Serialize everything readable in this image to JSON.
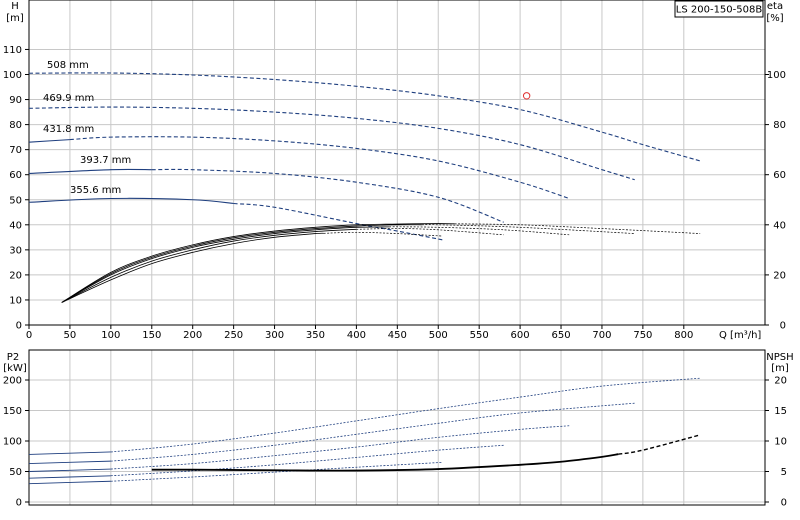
{
  "title_box": "LS 200-150-508B",
  "colors": {
    "curve": "#1f3f7f",
    "efficiency": "#000000",
    "grid": "#c8c8c8",
    "marker": "#e03030",
    "axis": "#000000"
  },
  "chart_data": [
    {
      "type": "line",
      "name": "performance",
      "left_axis": {
        "label_line1": "H",
        "label_line2": "[m]",
        "range": [
          0,
          120
        ],
        "ticks": [
          0,
          10,
          20,
          30,
          40,
          50,
          60,
          70,
          80,
          90,
          100,
          110
        ]
      },
      "right_axis": {
        "label_line1": "eta",
        "label_line2": "[%]",
        "range": [
          0,
          120
        ],
        "ticks": [
          0,
          20,
          40,
          60,
          80,
          100
        ]
      },
      "x_axis": {
        "label": "Q [m³/h]",
        "range": [
          0,
          900
        ],
        "ticks": [
          0,
          50,
          100,
          150,
          200,
          250,
          300,
          350,
          400,
          450,
          500,
          550,
          600,
          650,
          700,
          750,
          800
        ]
      },
      "grid": true,
      "head_curves": [
        {
          "name": "508 mm",
          "q_solid_end": 0,
          "points": [
            [
              0,
              100.5
            ],
            [
              100,
              100.6
            ],
            [
              200,
              99.8
            ],
            [
              300,
              98
            ],
            [
              400,
              95.3
            ],
            [
              500,
              91.5
            ],
            [
              600,
              86
            ],
            [
              700,
              77
            ],
            [
              750,
              72
            ],
            [
              820,
              65.5
            ]
          ]
        },
        {
          "name": "469.9 mm",
          "q_solid_end": 0,
          "points": [
            [
              0,
              86.5
            ],
            [
              100,
              87
            ],
            [
              200,
              86.5
            ],
            [
              300,
              85
            ],
            [
              400,
              82.5
            ],
            [
              500,
              78.5
            ],
            [
              600,
              72
            ],
            [
              700,
              62
            ],
            [
              740,
              58
            ]
          ]
        },
        {
          "name": "431.8 mm",
          "q_solid_end": 50,
          "points": [
            [
              0,
              73
            ],
            [
              100,
              75
            ],
            [
              200,
              75
            ],
            [
              300,
              73.5
            ],
            [
              400,
              70.5
            ],
            [
              500,
              65.5
            ],
            [
              600,
              57
            ],
            [
              660,
              50.5
            ]
          ]
        },
        {
          "name": "393.7 mm",
          "q_solid_end": 150,
          "points": [
            [
              0,
              60.5
            ],
            [
              100,
              62
            ],
            [
              200,
              62
            ],
            [
              300,
              60.5
            ],
            [
              400,
              57
            ],
            [
              500,
              51
            ],
            [
              580,
              41
            ]
          ]
        },
        {
          "name": "355.6 mm",
          "q_solid_end": 250,
          "points": [
            [
              0,
              49
            ],
            [
              100,
              50.5
            ],
            [
              200,
              50
            ],
            [
              300,
              47
            ],
            [
              400,
              40.5
            ],
            [
              450,
              37.5
            ],
            [
              505,
              34
            ]
          ]
        }
      ],
      "efficiency_curves": [
        {
          "name": "508 mm",
          "q_solid_end": 520,
          "points": [
            [
              40,
              9
            ],
            [
              100,
              21
            ],
            [
              150,
              27.5
            ],
            [
              200,
              32
            ],
            [
              250,
              35.3
            ],
            [
              300,
              37.5
            ],
            [
              350,
              39
            ],
            [
              400,
              40
            ],
            [
              450,
              40.3
            ],
            [
              500,
              40.5
            ],
            [
              600,
              40
            ],
            [
              700,
              38.5
            ],
            [
              820,
              36.5
            ]
          ]
        },
        {
          "name": "469.9 mm",
          "q_solid_end": 480,
          "points": [
            [
              40,
              9
            ],
            [
              100,
              20.5
            ],
            [
              150,
              27
            ],
            [
              200,
              31.5
            ],
            [
              250,
              34.8
            ],
            [
              300,
              37
            ],
            [
              350,
              38.5
            ],
            [
              400,
              39.5
            ],
            [
              450,
              40
            ],
            [
              500,
              40
            ],
            [
              600,
              39
            ],
            [
              740,
              36.5
            ]
          ]
        },
        {
          "name": "431.8 mm",
          "q_solid_end": 440,
          "points": [
            [
              40,
              9
            ],
            [
              100,
              20
            ],
            [
              150,
              26.5
            ],
            [
              200,
              31
            ],
            [
              250,
              34.2
            ],
            [
              300,
              36.5
            ],
            [
              350,
              38
            ],
            [
              400,
              39
            ],
            [
              450,
              39.2
            ],
            [
              500,
              39
            ],
            [
              580,
              38
            ],
            [
              660,
              36
            ]
          ]
        },
        {
          "name": "393.7 mm",
          "q_solid_end": 400,
          "points": [
            [
              40,
              9
            ],
            [
              100,
              19
            ],
            [
              150,
              25.5
            ],
            [
              200,
              30
            ],
            [
              250,
              33.5
            ],
            [
              300,
              35.8
            ],
            [
              350,
              37.3
            ],
            [
              400,
              38.2
            ],
            [
              450,
              38.5
            ],
            [
              500,
              38
            ],
            [
              580,
              36
            ]
          ]
        },
        {
          "name": "355.6 mm",
          "q_solid_end": 360,
          "points": [
            [
              40,
              9
            ],
            [
              100,
              18
            ],
            [
              150,
              24.5
            ],
            [
              200,
              29
            ],
            [
              250,
              32.5
            ],
            [
              300,
              35
            ],
            [
              350,
              36.5
            ],
            [
              400,
              37
            ],
            [
              450,
              36.5
            ],
            [
              505,
              35.5
            ]
          ]
        }
      ],
      "marker": {
        "q": 608,
        "h": 91.5
      }
    },
    {
      "type": "line",
      "name": "power_npsh",
      "left_axis": {
        "label_line1": "P2",
        "label_line2": "[kW]",
        "range": [
          0,
          220
        ],
        "ticks": [
          0,
          50,
          100,
          150,
          200
        ]
      },
      "right_axis": {
        "label_line1": "NPSH",
        "label_line2": "[m]",
        "range": [
          0,
          22
        ],
        "ticks": [
          0,
          5,
          10,
          15,
          20
        ]
      },
      "x_axis": {
        "range": [
          0,
          900
        ]
      },
      "grid": true,
      "power_curves": [
        {
          "name": "508 mm",
          "points": [
            [
              0,
              78
            ],
            [
              100,
              82
            ],
            [
              200,
              95
            ],
            [
              300,
              113
            ],
            [
              400,
              133
            ],
            [
              500,
              153
            ],
            [
              600,
              172
            ],
            [
              700,
              190
            ],
            [
              820,
              203
            ]
          ]
        },
        {
          "name": "469.9 mm",
          "points": [
            [
              0,
              63
            ],
            [
              100,
              67
            ],
            [
              200,
              78
            ],
            [
              300,
              93
            ],
            [
              400,
              111
            ],
            [
              500,
              129
            ],
            [
              600,
              146
            ],
            [
              740,
              162
            ]
          ]
        },
        {
          "name": "431.8 mm",
          "points": [
            [
              0,
              50
            ],
            [
              100,
              54
            ],
            [
              200,
              63
            ],
            [
              300,
              76
            ],
            [
              400,
              90
            ],
            [
              500,
              106
            ],
            [
              600,
              119
            ],
            [
              660,
              125
            ]
          ]
        },
        {
          "name": "393.7 mm",
          "points": [
            [
              0,
              39
            ],
            [
              100,
              43
            ],
            [
              200,
              51
            ],
            [
              300,
              61
            ],
            [
              400,
              73
            ],
            [
              500,
              85
            ],
            [
              580,
              93
            ]
          ]
        },
        {
          "name": "355.6 mm",
          "points": [
            [
              0,
              30
            ],
            [
              100,
              34
            ],
            [
              200,
              41
            ],
            [
              300,
              49
            ],
            [
              400,
              57
            ],
            [
              505,
              65
            ]
          ]
        }
      ],
      "npsh_curve": {
        "q_solid_end": 720,
        "points": [
          [
            150,
            5.3
          ],
          [
            200,
            5.3
          ],
          [
            300,
            5.2
          ],
          [
            400,
            5.15
          ],
          [
            500,
            5.4
          ],
          [
            600,
            6.1
          ],
          [
            650,
            6.6
          ],
          [
            700,
            7.4
          ],
          [
            750,
            8.5
          ],
          [
            820,
            11
          ]
        ]
      }
    }
  ]
}
